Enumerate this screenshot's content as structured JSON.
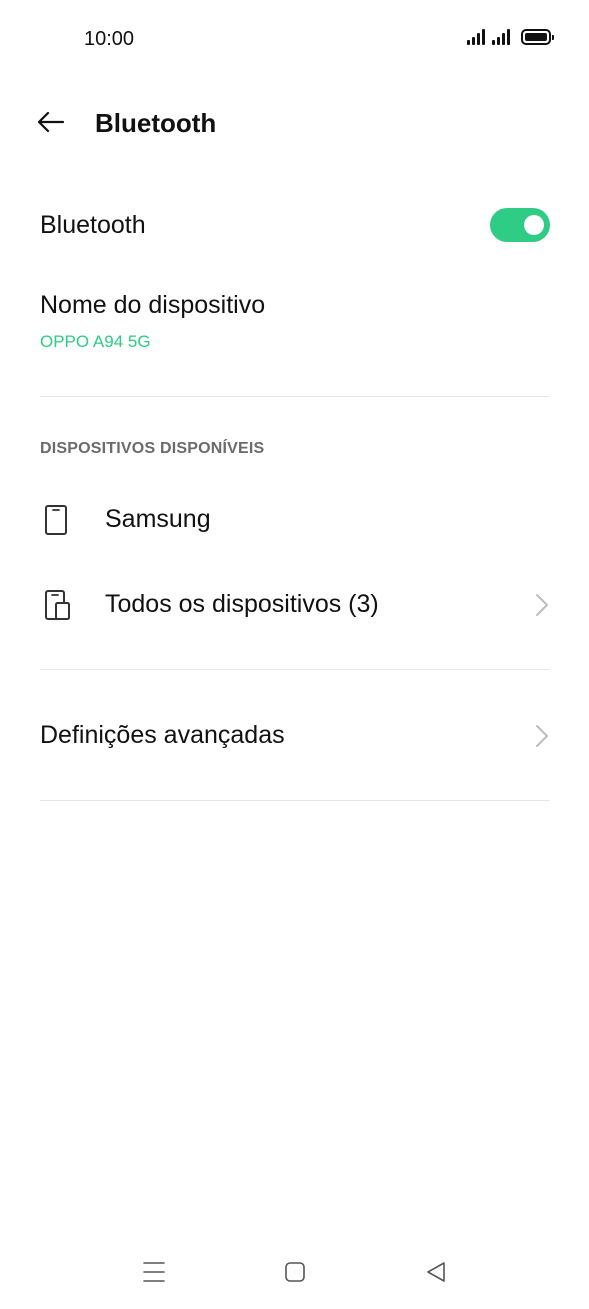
{
  "status_bar": {
    "time": "10:00",
    "icons": [
      "signal-sim1-icon",
      "signal-sim2-icon",
      "battery-icon"
    ]
  },
  "app_bar": {
    "back_icon": "arrow-left-icon",
    "title": "Bluetooth"
  },
  "bluetooth_toggle": {
    "label": "Bluetooth",
    "state": "on",
    "accent_color": "#2ecc84"
  },
  "device_name": {
    "label": "Nome do dispositivo",
    "value": "OPPO A94 5G"
  },
  "available_devices": {
    "header": "DISPOSITIVOS DISPONÍVEIS",
    "items": [
      {
        "label": "Samsung",
        "icon": "phone-icon",
        "has_chevron": false
      },
      {
        "label": "Todos os dispositivos (3)",
        "icon": "multi-device-icon",
        "has_chevron": true
      }
    ]
  },
  "advanced": {
    "label": "Definições avançadas",
    "has_chevron": true
  },
  "nav_bar": {
    "icons": [
      "menu-icon",
      "home-icon",
      "back-triangle-icon"
    ]
  }
}
